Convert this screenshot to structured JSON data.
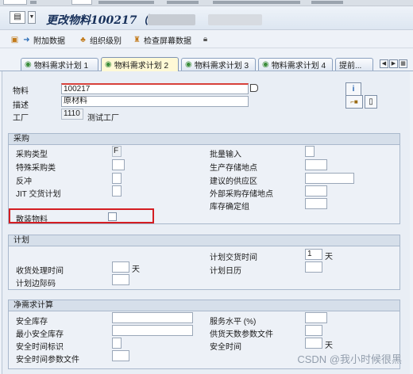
{
  "window": {
    "app_icon": "document-icon",
    "title": "更改物料100217（"
  },
  "toolbar": {
    "items": [
      {
        "icon": "additional-data-icon",
        "label": "附加数据"
      },
      {
        "icon": "org-levels-icon",
        "label": "组织级别"
      },
      {
        "icon": "check-screen-data-icon",
        "label": "检查屏幕数据"
      },
      {
        "icon": "lock-icon",
        "label": ""
      }
    ]
  },
  "tabs": [
    {
      "label": "物料需求计划 1",
      "active": false
    },
    {
      "label": "物料需求计划 2",
      "active": true
    },
    {
      "label": "物料需求计划 3",
      "active": false
    },
    {
      "label": "物料需求计划 4",
      "active": false
    },
    {
      "label": "提前...",
      "active": false
    }
  ],
  "header": {
    "material_label": "物料",
    "material_value": "100217",
    "description_label": "描述",
    "description_value": "原材料",
    "plant_label": "工厂",
    "plant_value": "1110",
    "plant_name": "测试工厂"
  },
  "procurement": {
    "title": "采购",
    "proc_type_label": "采购类型",
    "proc_type_value": "F",
    "special_proc_label": "特殊采购类",
    "backflush_label": "反冲",
    "jit_label": "JIT 交货计划",
    "bulk_material_label": "散装物料",
    "batch_entry_label": "批量输入",
    "prod_storage_label": "生产存储地点",
    "default_supply_area_label": "建议的供应区",
    "ext_storage_label": "外部采购存储地点",
    "storage_bin_label": "库存确定组"
  },
  "scheduling": {
    "title": "计划",
    "plan_delivery_time_label": "计划交货时间",
    "plan_delivery_time_value": "1",
    "plan_delivery_time_unit": "天",
    "gr_processing_time_label": "收货处理时间",
    "gr_processing_time_unit": "天",
    "planning_calendar_label": "计划日历",
    "sched_margin_key_label": "计划边际码"
  },
  "net_requirements": {
    "title": "净需求计算",
    "safety_stock_label": "安全库存",
    "min_safety_stock_label": "最小安全库存",
    "safety_time_ind_label": "安全时间标识",
    "safety_time_profile_label": "安全时间参数文件",
    "service_level_label": "服务水平 (%)",
    "coverage_profile_label": "供货天数参数文件",
    "safety_time_label": "安全时间",
    "safety_time_unit": "天"
  },
  "watermark": "CSDN @我小时候很黑"
}
